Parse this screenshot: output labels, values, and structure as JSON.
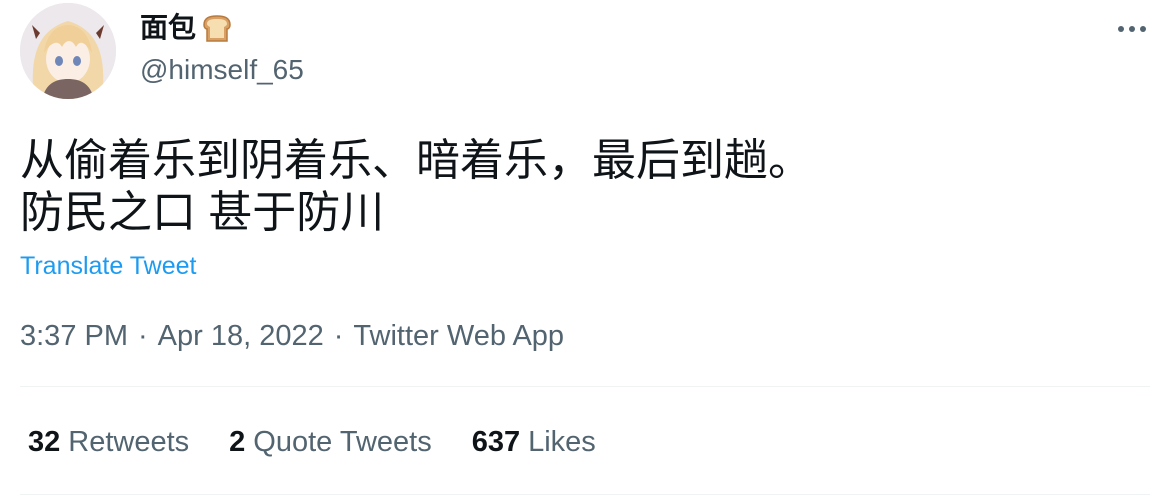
{
  "author": {
    "display_name": "面包",
    "emoji_icon": "bread-icon",
    "handle": "@himself_65",
    "avatar_icon": "anime-avatar"
  },
  "tweet": {
    "text": "从偷着乐到阴着乐、暗着乐，最后到趟。\n防民之口 甚于防川",
    "translate_label": "Translate Tweet"
  },
  "meta": {
    "time": "3:37 PM",
    "separator": "·",
    "date": "Apr 18, 2022",
    "source": "Twitter Web App"
  },
  "stats": {
    "retweets_count": "32",
    "retweets_label": "Retweets",
    "quotes_count": "2",
    "quotes_label": "Quote Tweets",
    "likes_count": "637",
    "likes_label": "Likes"
  },
  "colors": {
    "text": "#0f1419",
    "secondary": "#536471",
    "link": "#1d9bf0",
    "divider": "#eff3f4"
  }
}
